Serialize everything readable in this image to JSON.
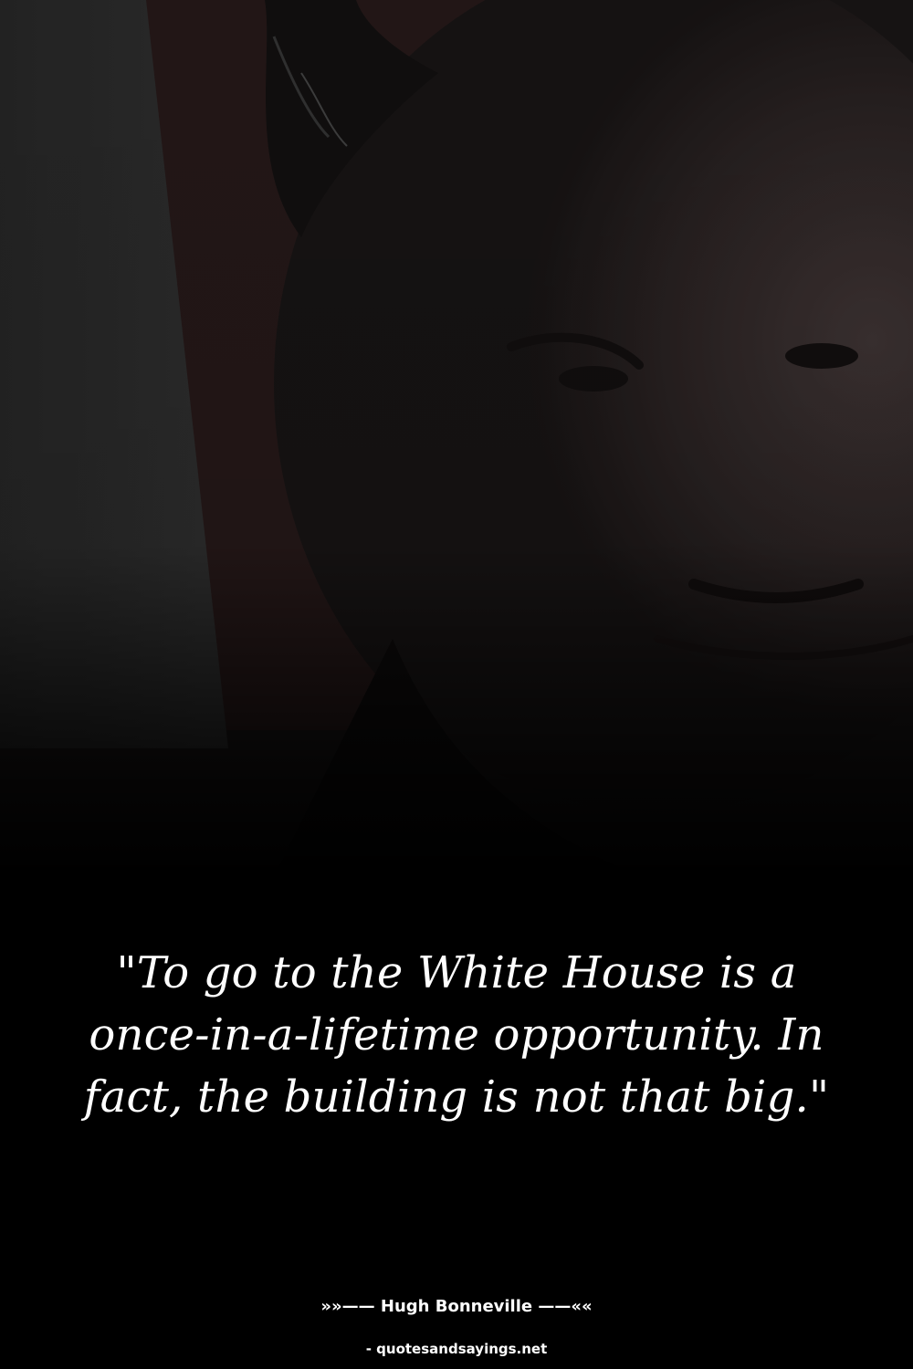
{
  "quote": {
    "text": "\"To go to the White House is a once-in-a-lifetime opportunity. In fact, the building is not that big.\""
  },
  "attribution": {
    "author_line": "»»—— Hugh Bonneville ——««"
  },
  "footer": {
    "source": "- quotesandsayings.net"
  },
  "colors": {
    "background": "#000000",
    "text": "#ffffff"
  }
}
